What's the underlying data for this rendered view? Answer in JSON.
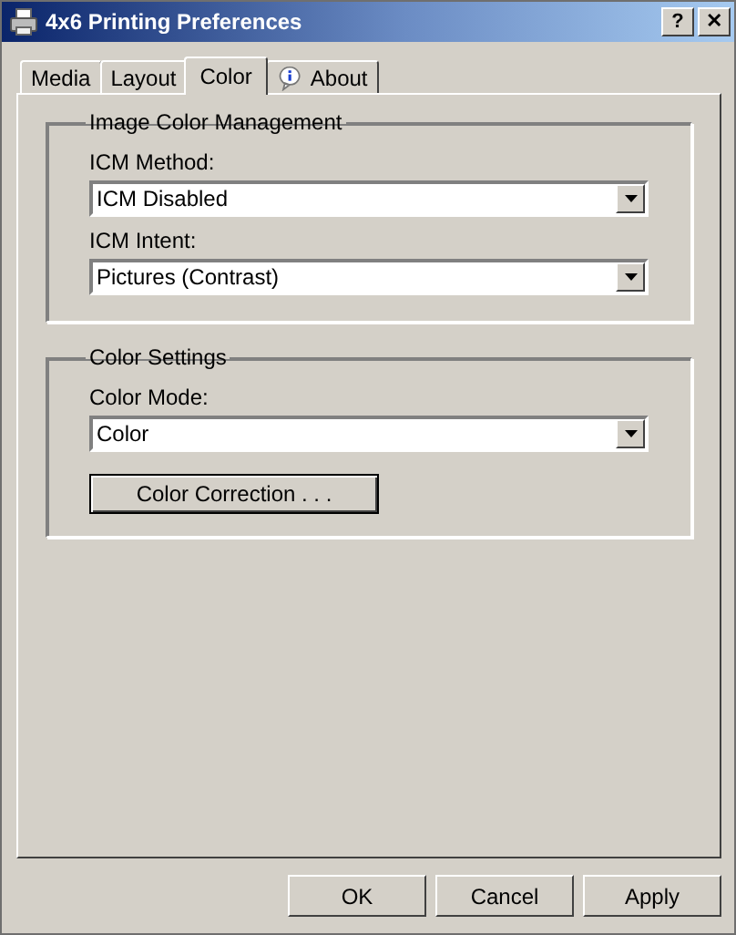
{
  "window": {
    "title": "4x6 Printing Preferences",
    "title_buttons": [
      "?",
      "✕"
    ]
  },
  "tabs": [
    {
      "label": "Media",
      "selected": false,
      "kind": "text"
    },
    {
      "label": "Layout",
      "selected": false,
      "kind": "text"
    },
    {
      "label": "Color",
      "selected": true,
      "kind": "text"
    },
    {
      "label": "About",
      "selected": false,
      "kind": "info"
    }
  ],
  "groups": [
    {
      "title": "Image Color Management",
      "items": [
        {
          "kind": "dropdown",
          "label": "ICM Method:",
          "value": "ICM Disabled"
        },
        {
          "kind": "dropdown",
          "label": "ICM Intent:",
          "value": "Pictures (Contrast)"
        }
      ]
    },
    {
      "title": "Color Settings",
      "items": [
        {
          "kind": "dropdown",
          "label": "Color Mode:",
          "value": "Color"
        },
        {
          "kind": "button",
          "label": "Color Correction . . ."
        }
      ]
    }
  ],
  "buttons": [
    "OK",
    "Cancel",
    "Apply"
  ]
}
